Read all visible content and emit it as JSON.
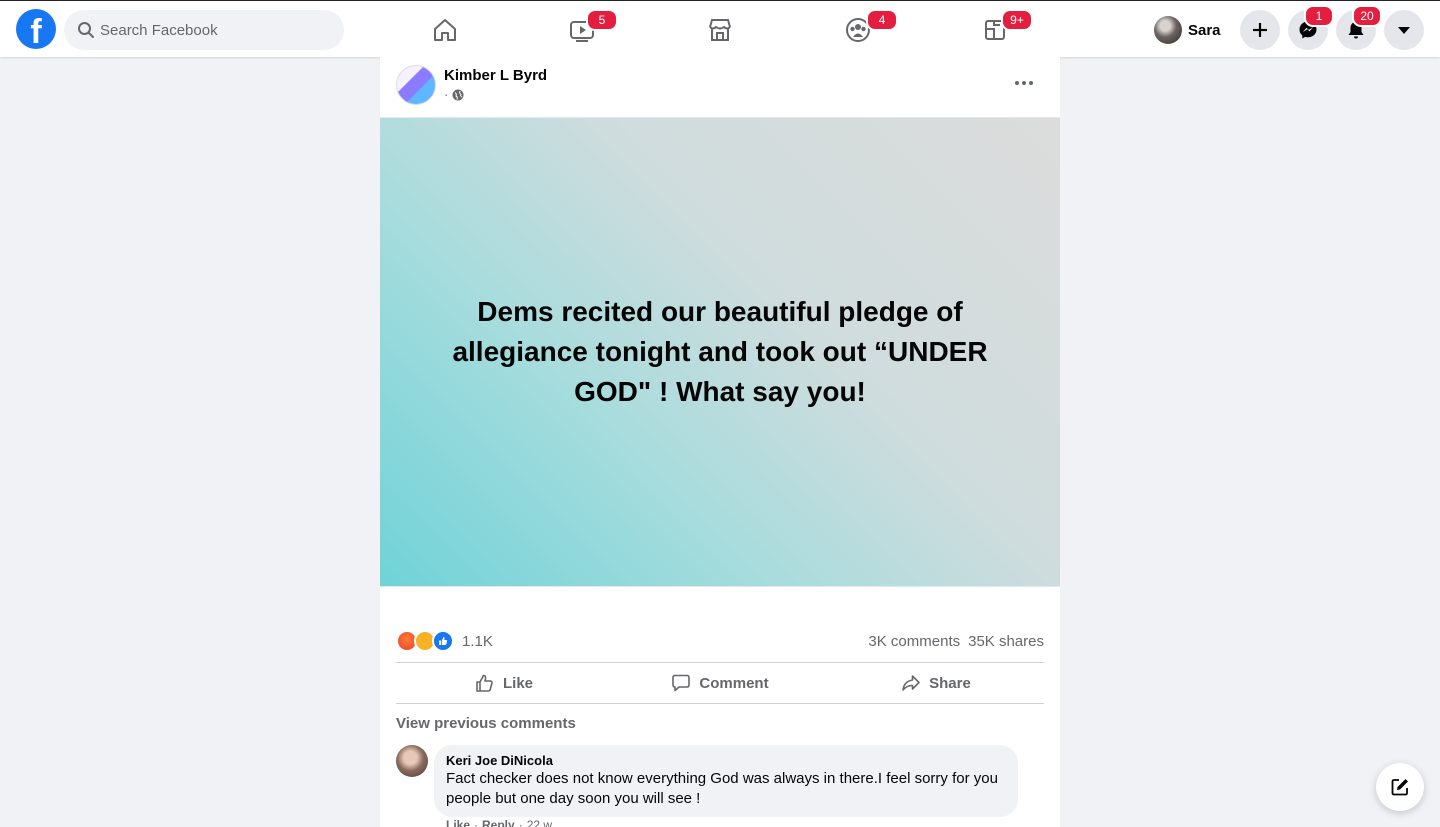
{
  "header": {
    "logo_letter": "f",
    "search": {
      "placeholder": "Search Facebook"
    },
    "nav": [
      {
        "name": "home-icon",
        "badge": ""
      },
      {
        "name": "watch-icon",
        "badge": "5"
      },
      {
        "name": "marketplace-icon",
        "badge": ""
      },
      {
        "name": "groups-icon",
        "badge": "4"
      },
      {
        "name": "gaming-icon",
        "badge": "9+"
      }
    ],
    "profile_name": "Sara",
    "messenger_badge": "1",
    "notifications_badge": "20"
  },
  "post": {
    "author": "Kimber L Byrd",
    "meta_separator": "·",
    "image_text": "Dems recited our beautiful pledge of allegiance tonight and took out “UNDER GOD\" ! What say you!",
    "reactions": [
      "angry",
      "haha",
      "like"
    ],
    "reaction_count": "1.1K",
    "comments_count": "3K comments",
    "shares_count": "35K shares",
    "actions": {
      "like": "Like",
      "comment": "Comment",
      "share": "Share"
    },
    "view_previous": "View previous comments",
    "comment": {
      "author": "Keri Joe DiNicola",
      "text": "Fact checker does not know everything God was always in there.I feel sorry for you people but one day soon you will see !",
      "like": "Like",
      "reply": "Reply",
      "sep": "·",
      "time": "22 w"
    }
  },
  "colors": {
    "brand": "#1877f2",
    "badge": "#e41e3f",
    "secondary_text": "#65676b"
  }
}
